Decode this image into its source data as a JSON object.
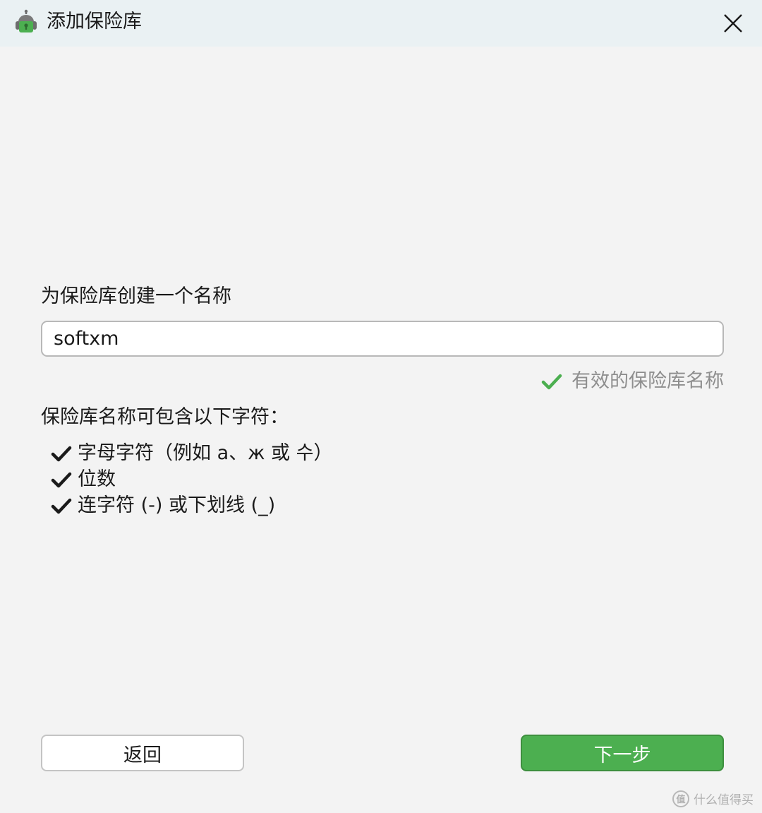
{
  "window": {
    "title": "添加保险库",
    "app_icon": "robot-lock-icon",
    "close_icon": "close-icon"
  },
  "form": {
    "name_label": "为保险库创建一个名称",
    "name_value": "softxm",
    "validation_text": "有效的保险库名称",
    "validation_icon": "check-icon",
    "validation_color": "#4caf50"
  },
  "rules": {
    "heading": "保险库名称可包含以下字符：",
    "items": [
      {
        "label": "字母字符（例如 a、ж 或 수）",
        "icon": "check-icon"
      },
      {
        "label": "位数",
        "icon": "check-icon"
      },
      {
        "label": "连字符 (-) 或下划线 (_)",
        "icon": "check-icon"
      }
    ]
  },
  "footer": {
    "back_label": "返回",
    "next_label": "下一步",
    "next_color": "#4caf50"
  },
  "watermark": {
    "logo_text": "值",
    "text": "什么值得买"
  }
}
